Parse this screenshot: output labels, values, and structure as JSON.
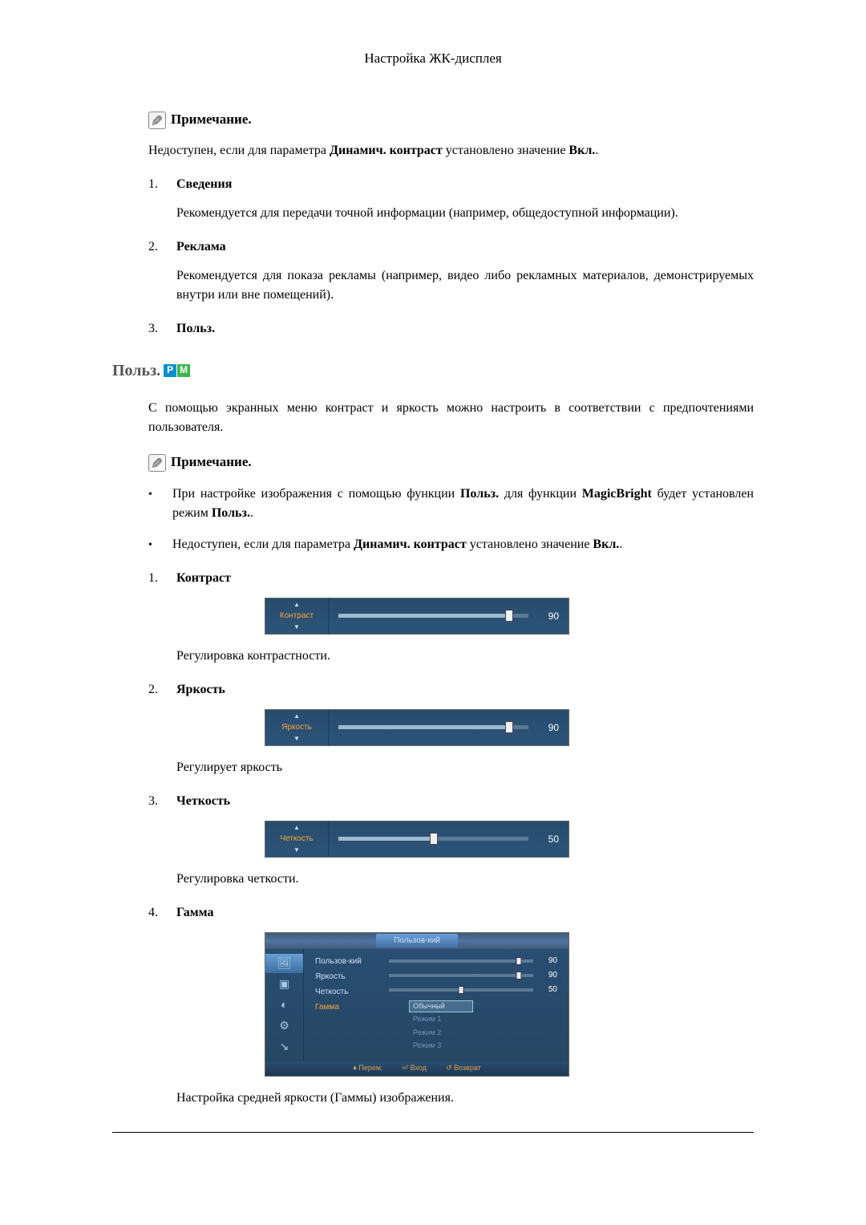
{
  "header": {
    "title": "Настройка ЖК-дисплея"
  },
  "note1": {
    "heading": "Примечание.",
    "text_before": "Недоступен, если для параметра ",
    "bold1": "Динамич. контраст",
    "text_mid": " установлено значение ",
    "bold2": "Вкл.",
    "text_after": "."
  },
  "list1": [
    {
      "num": "1.",
      "title": "Сведения",
      "body": "Рекомендуется для передачи точной информации (например, общедоступной информации)."
    },
    {
      "num": "2.",
      "title": "Реклама",
      "body": "Рекомендуется для показа рекламы (например, видео либо рекламных материалов, демонстрируемых внутри или вне помещений)."
    },
    {
      "num": "3.",
      "title": "Польз.",
      "body": ""
    }
  ],
  "section": {
    "heading": "Польз.",
    "badge_p": "P",
    "badge_m": "M",
    "intro": "С помощью экранных меню контраст и яркость можно настроить в соответствии с предпочтениями пользователя.",
    "note_heading": "Примечание."
  },
  "bullets": [
    {
      "pre": "При настройке изображения с помощью функции ",
      "b1": "Польз.",
      "mid1": " для функции ",
      "b2": "MagicBright",
      "mid2": " будет установлен режим ",
      "b3": "Польз.",
      "end": "."
    },
    {
      "pre": "Недоступен, если для параметра ",
      "b1": "Динамич. контраст",
      "mid1": " установлено значение ",
      "b2": "Вкл.",
      "mid2": "",
      "b3": "",
      "end": "."
    }
  ],
  "list2": [
    {
      "num": "1.",
      "title": "Контраст",
      "slider": {
        "label": "Контраст",
        "value": 90,
        "pos": 90
      },
      "body": "Регулировка контрастности."
    },
    {
      "num": "2.",
      "title": "Яркость",
      "slider": {
        "label": "Яркость",
        "value": 90,
        "pos": 90
      },
      "body": "Регулирует яркость"
    },
    {
      "num": "3.",
      "title": "Четкость",
      "slider": {
        "label": "Четкость",
        "value": 50,
        "pos": 50
      },
      "body": "Регулировка четкости."
    },
    {
      "num": "4.",
      "title": "Гамма",
      "body": "Настройка средней яркости (Гаммы) изображения."
    }
  ],
  "gamma_menu": {
    "header_tab": "Пользов-кий",
    "labels": [
      "Пользов-кий",
      "Яркость",
      "Четкость",
      "Гамма"
    ],
    "rows": [
      {
        "value": 90,
        "pos": 90
      },
      {
        "value": 90,
        "pos": 90
      },
      {
        "value": 50,
        "pos": 50
      }
    ],
    "options": [
      "Обычный",
      "Режим 1",
      "Режим 2",
      "Режим 3"
    ],
    "footer": {
      "move": "Перем.",
      "enter": "Вход",
      "return": "Возврат"
    }
  }
}
